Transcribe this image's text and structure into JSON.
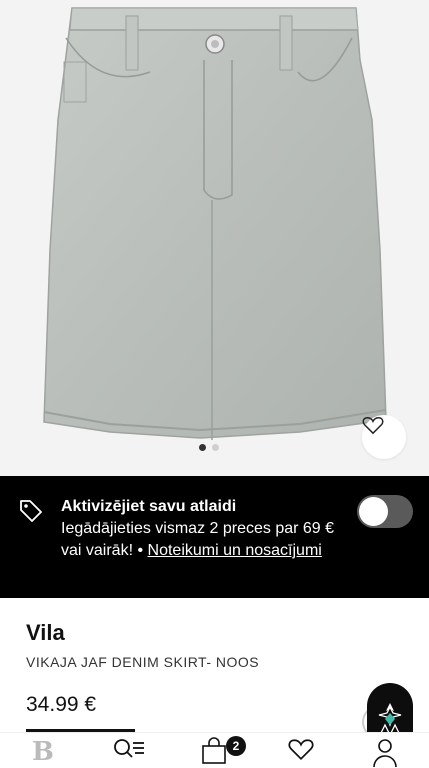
{
  "product": {
    "brand": "Vila",
    "name": "VIKAJA JAF DENIM SKIRT- NOOS",
    "price": "34.99 €",
    "image_dots": 2,
    "active_dot": 1
  },
  "promo": {
    "title": "Aktivizējiet savu atlaidi",
    "description": "Iegādājieties vismaz 2 preces par 69 € vai vairāk! •",
    "link": "Noteikumi un nosacījumi",
    "toggle_on": false
  },
  "tabbar": {
    "items": [
      {
        "name": "home",
        "icon": "brand-logo-icon"
      },
      {
        "name": "search",
        "icon": "search-menu-icon"
      },
      {
        "name": "bag",
        "icon": "shopping-bag-icon",
        "badge": "2"
      },
      {
        "name": "wishlist",
        "icon": "heart-icon"
      },
      {
        "name": "account",
        "icon": "user-icon"
      }
    ],
    "logo_letter": "B",
    "active": "search"
  },
  "colors": {
    "promo_bg": "#000000",
    "denim": "#bfc3bf",
    "toggle_off": "#5a5a5a"
  }
}
